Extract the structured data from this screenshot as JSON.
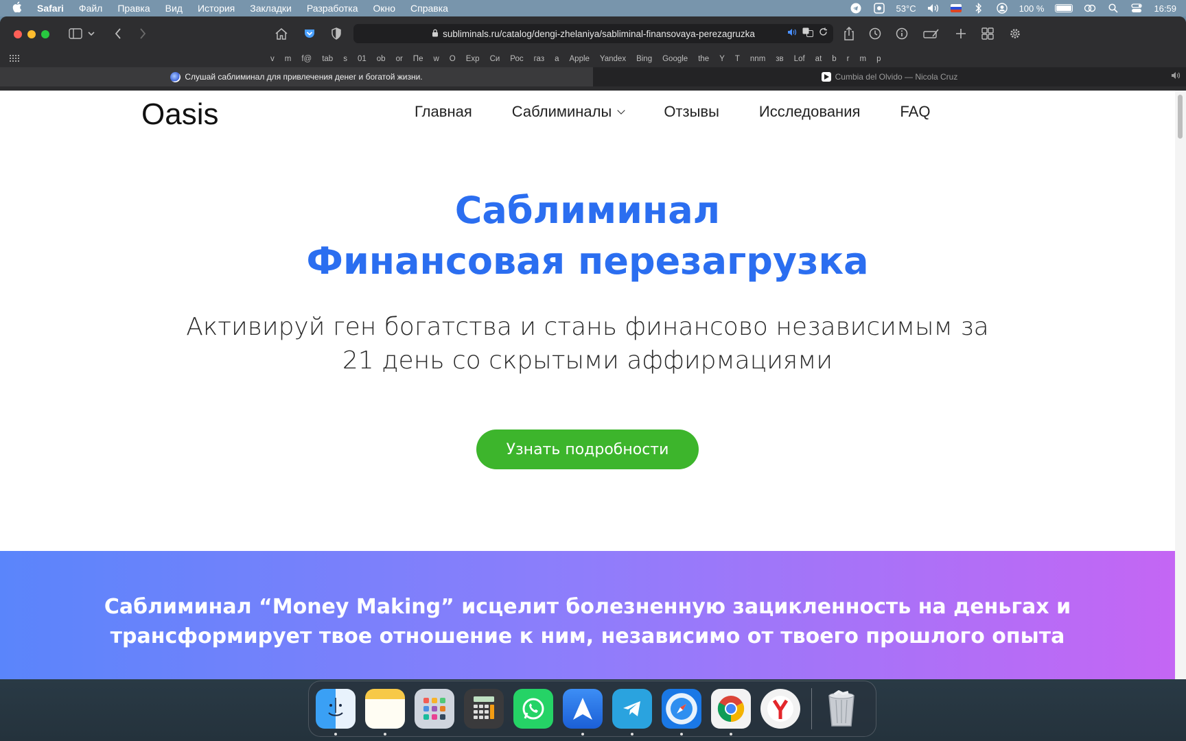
{
  "menubar": {
    "apple": "",
    "app_name": "Safari",
    "menus": [
      "Файл",
      "Правка",
      "Вид",
      "История",
      "Закладки",
      "Разработка",
      "Окно",
      "Справка"
    ],
    "temperature": "53°C",
    "battery": "100 %",
    "time": "16:59"
  },
  "browser": {
    "url": "subliminals.ru/catalog/dengi-zhelaniya/sabliminal-finansovaya-perezagruzka",
    "favorites": [
      "v",
      "m",
      "f@",
      "tab",
      "s",
      "01",
      "ob",
      "or",
      "Пе",
      "w",
      "O",
      "Exp",
      "Си",
      "Рос",
      "газ",
      "a",
      "Apple",
      "Yandex",
      "Bing",
      "Google",
      "the",
      "Y",
      "T",
      "nnm",
      "зв",
      "Lof",
      "at",
      "b",
      "r",
      "m",
      "p"
    ],
    "tabs": [
      {
        "title": "Слушай саблиминал для привлечения денег и богатой жизни."
      },
      {
        "title": "Cumbia del Olvido — Nicola Cruz"
      }
    ]
  },
  "site": {
    "logo": "Oasis",
    "nav": [
      "Главная",
      "Саблиминалы",
      "Отзывы",
      "Исследования",
      "FAQ"
    ],
    "hero": {
      "title_line1": "Саблиминал",
      "title_line2": "Финансовая перезагрузка",
      "sub_line1": "Активируй ген богатства и стань финансово независимым за",
      "sub_line2": "21 день со скрытыми аффирмациями",
      "cta": "Узнать подробности"
    },
    "banner": {
      "line1": "Саблиминал “Money Making” исцелит болезненную зацикленность на деньгах и",
      "line2": "трансформирует твое отношение к ним, независимо от твоего прошлого опыта"
    }
  },
  "colors": {
    "hero_title": "#2b6ef0",
    "cta": "#3db52c",
    "banner_start": "#5a85fb",
    "banner_end": "#c466f4"
  },
  "dock": {
    "apps": [
      "finder-icon",
      "notes-icon",
      "launchpad-icon",
      "calculator-icon",
      "whatsapp-icon",
      "spark-mail-icon",
      "telegram-icon",
      "safari-icon",
      "chrome-icon",
      "yandex-browser-icon",
      "trash-icon"
    ]
  }
}
